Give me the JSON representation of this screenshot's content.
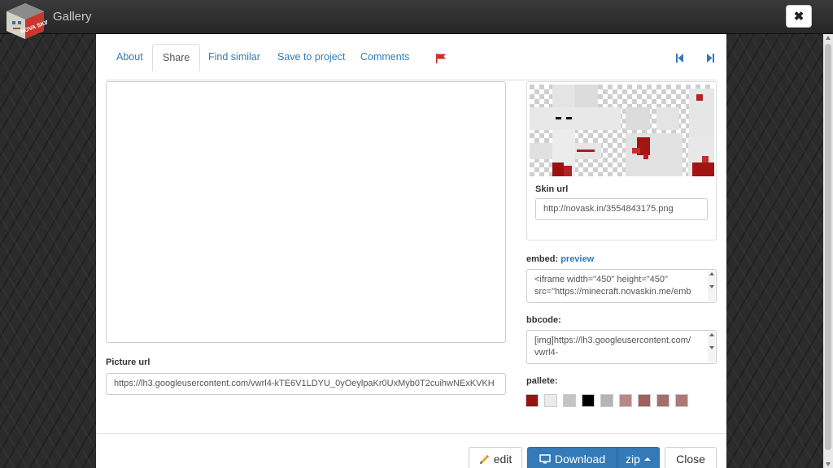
{
  "app": {
    "title": "Gallery",
    "logo_text": "NOVA SKIN",
    "close_icon": "close-icon"
  },
  "tabs": [
    {
      "label": "About",
      "active": false
    },
    {
      "label": "Share",
      "active": true
    },
    {
      "label": "Find similar",
      "active": false
    },
    {
      "label": "Save to project",
      "active": false
    },
    {
      "label": "Comments",
      "active": false
    }
  ],
  "icons": {
    "report": "flag-icon",
    "first": "skip-to-start-icon",
    "next": "skip-forward-icon"
  },
  "picture": {
    "label": "Picture url",
    "value": "https://lh3.googleusercontent.com/vwrl4-kTE6V1LDYU_0yOeylpaKr0UxMyb0T2cuihwNExKVKH"
  },
  "skin": {
    "label": "Skin url",
    "value": "http://novask.in/3554843175.png"
  },
  "embed": {
    "label": "embed:",
    "link": "preview",
    "value": "<iframe width=\"450\" height=\"450\" src=\"https://minecraft.novaskin.me/emb"
  },
  "bbcode": {
    "label": "bbcode:",
    "value": "[img]https://lh3.googleusercontent.com/ vwrl4-"
  },
  "pallete": {
    "label": "pallete:",
    "colors": [
      "#9b1111",
      "#ebebeb",
      "#c4c4c4",
      "#000000",
      "#b5b5b5",
      "#b98884",
      "#a0605d",
      "#a36f6c",
      "#aa7a77"
    ]
  },
  "footer": {
    "edit": "edit",
    "download": "Download",
    "zip": "zip",
    "close": "Close"
  },
  "colors": {
    "link": "#337ab7",
    "primary": "#337ab7"
  }
}
